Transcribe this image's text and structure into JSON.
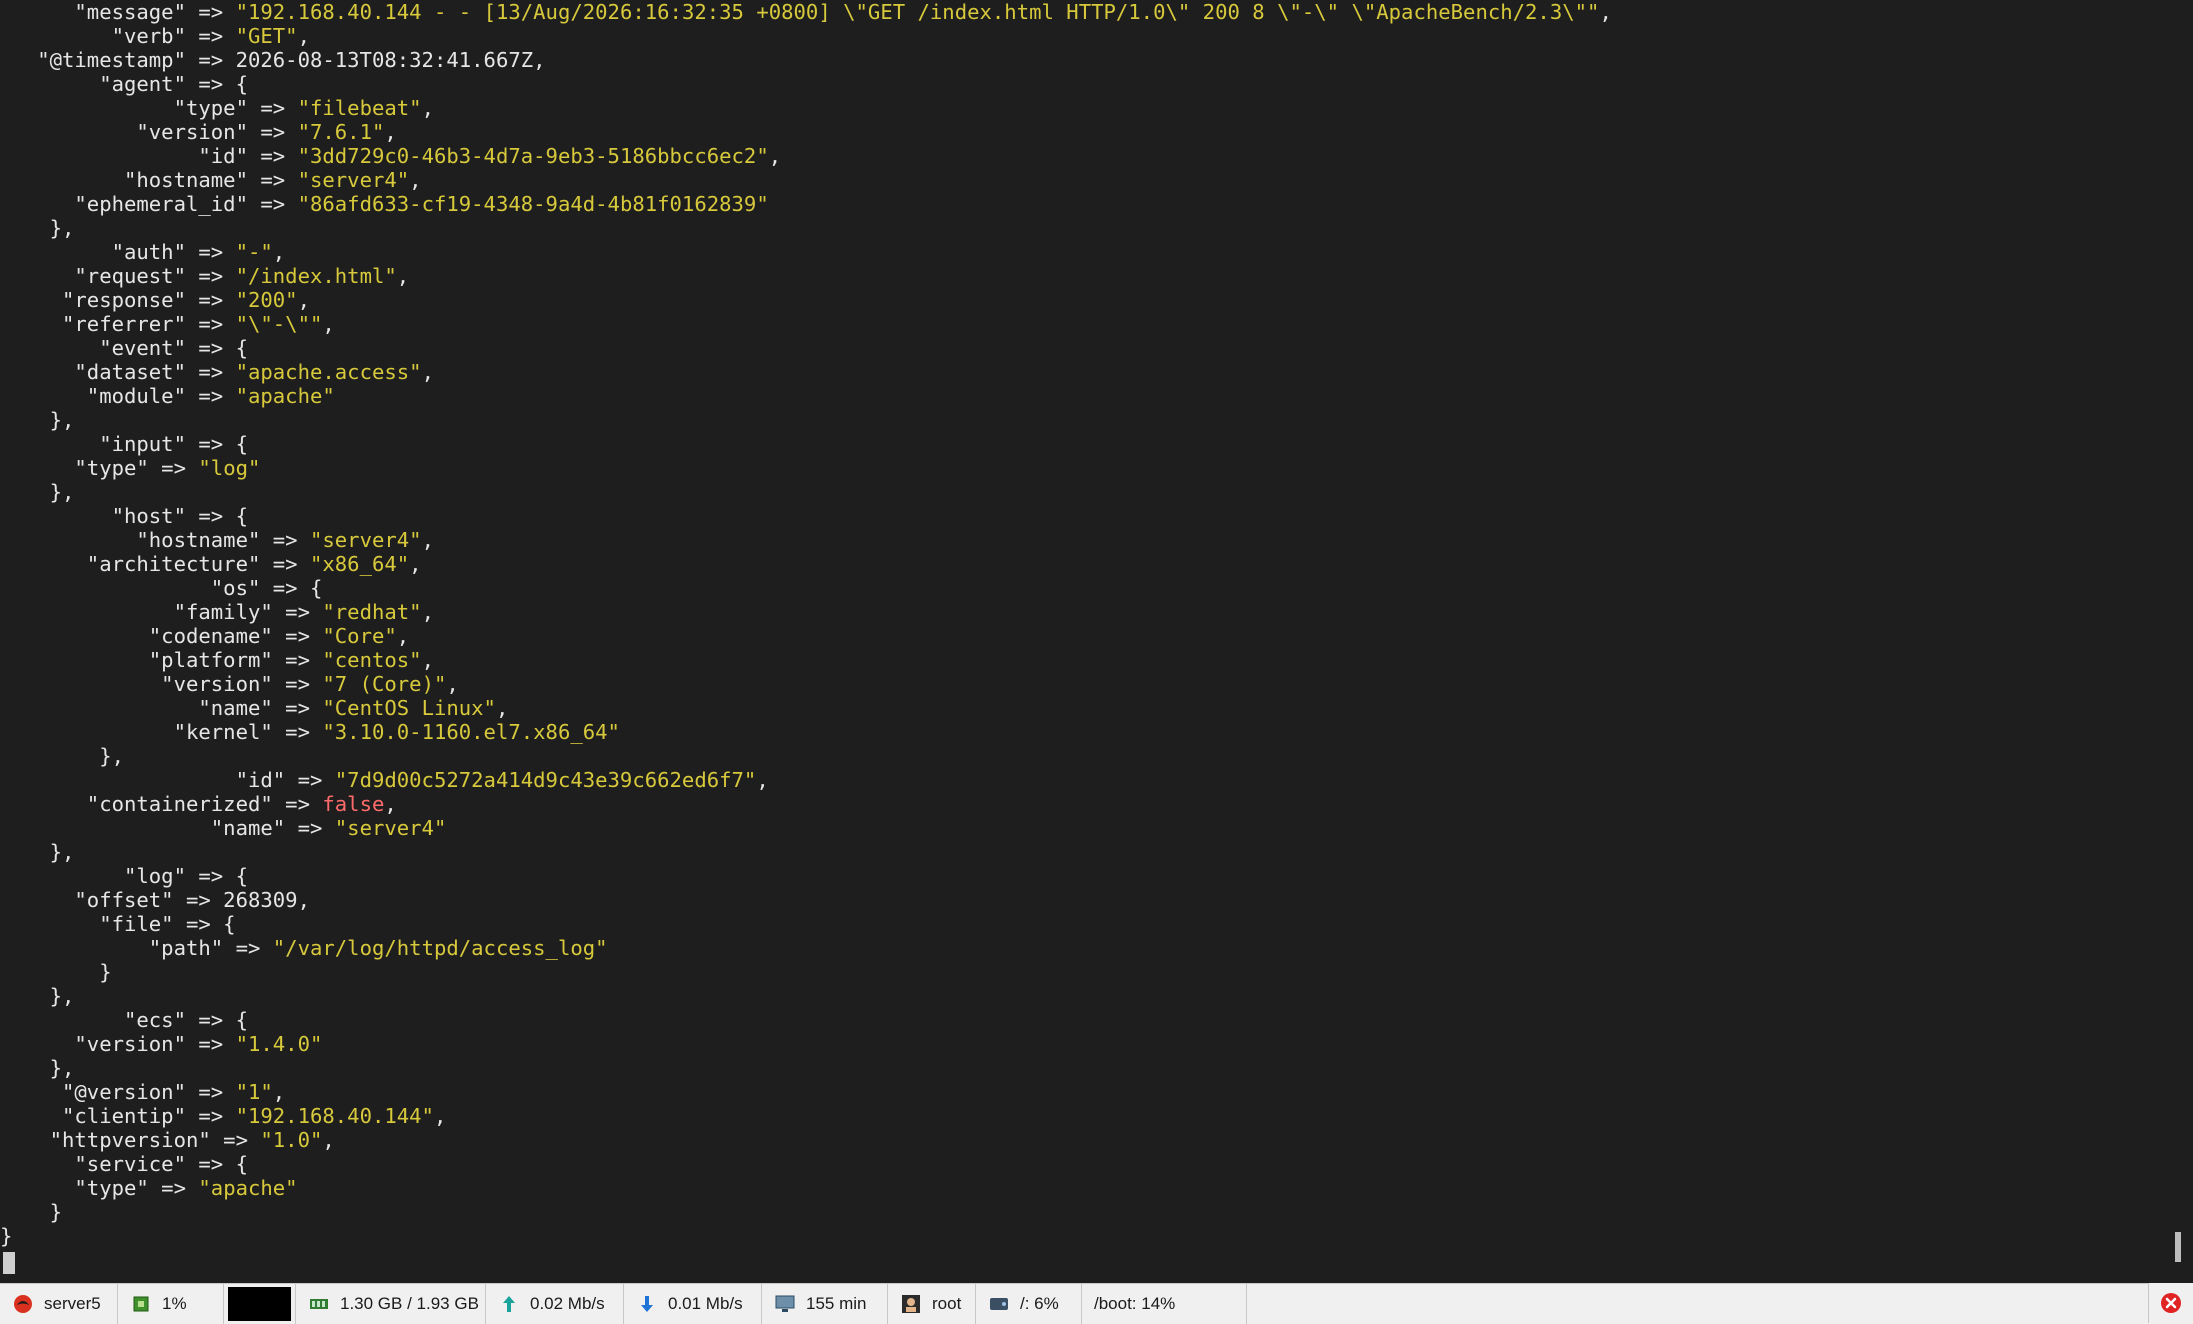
{
  "terminal": {
    "lines": [
      [
        {
          "t": "k",
          "v": "      \"message\""
        },
        {
          "t": "k",
          "v": " => "
        },
        {
          "t": "s",
          "v": "\"192.168.40.144 - - [13/Aug/2026:16:32:35 +0800] \\\"GET /index.html HTTP/1.0\\\" 200 8 \\\"-\\\" \\\"ApacheBench/2.3\\\"\""
        },
        {
          "t": "k",
          "v": ","
        }
      ],
      [
        {
          "t": "k",
          "v": "         \"verb\" => "
        },
        {
          "t": "s",
          "v": "\"GET\""
        },
        {
          "t": "k",
          "v": ","
        }
      ],
      [
        {
          "t": "k",
          "v": "   \"@timestamp\" => 2026-08-13T08:32:41.667Z,"
        }
      ],
      [
        {
          "t": "k",
          "v": "        \"agent\" => {"
        }
      ],
      [
        {
          "t": "k",
          "v": "              \"type\" => "
        },
        {
          "t": "s",
          "v": "\"filebeat\""
        },
        {
          "t": "k",
          "v": ","
        }
      ],
      [
        {
          "t": "k",
          "v": "           \"version\" => "
        },
        {
          "t": "s",
          "v": "\"7.6.1\""
        },
        {
          "t": "k",
          "v": ","
        }
      ],
      [
        {
          "t": "k",
          "v": "                \"id\" => "
        },
        {
          "t": "s",
          "v": "\"3dd729c0-46b3-4d7a-9eb3-5186bbcc6ec2\""
        },
        {
          "t": "k",
          "v": ","
        }
      ],
      [
        {
          "t": "k",
          "v": "          \"hostname\" => "
        },
        {
          "t": "s",
          "v": "\"server4\""
        },
        {
          "t": "k",
          "v": ","
        }
      ],
      [
        {
          "t": "k",
          "v": "      \"ephemeral_id\" => "
        },
        {
          "t": "s",
          "v": "\"86afd633-cf19-4348-9a4d-4b81f0162839\""
        }
      ],
      [
        {
          "t": "k",
          "v": "    },"
        }
      ],
      [
        {
          "t": "k",
          "v": "         \"auth\" => "
        },
        {
          "t": "s",
          "v": "\"-\""
        },
        {
          "t": "k",
          "v": ","
        }
      ],
      [
        {
          "t": "k",
          "v": "      \"request\" => "
        },
        {
          "t": "s",
          "v": "\"/index.html\""
        },
        {
          "t": "k",
          "v": ","
        }
      ],
      [
        {
          "t": "k",
          "v": "     \"response\" => "
        },
        {
          "t": "s",
          "v": "\"200\""
        },
        {
          "t": "k",
          "v": ","
        }
      ],
      [
        {
          "t": "k",
          "v": "     \"referrer\" => "
        },
        {
          "t": "s",
          "v": "\"\\\"-\\\"\""
        },
        {
          "t": "k",
          "v": ","
        }
      ],
      [
        {
          "t": "k",
          "v": "        \"event\" => {"
        }
      ],
      [
        {
          "t": "k",
          "v": "      \"dataset\" => "
        },
        {
          "t": "s",
          "v": "\"apache.access\""
        },
        {
          "t": "k",
          "v": ","
        }
      ],
      [
        {
          "t": "k",
          "v": "       \"module\" => "
        },
        {
          "t": "s",
          "v": "\"apache\""
        }
      ],
      [
        {
          "t": "k",
          "v": "    },"
        }
      ],
      [
        {
          "t": "k",
          "v": "        \"input\" => {"
        }
      ],
      [
        {
          "t": "k",
          "v": "      \"type\" => "
        },
        {
          "t": "s",
          "v": "\"log\""
        }
      ],
      [
        {
          "t": "k",
          "v": "    },"
        }
      ],
      [
        {
          "t": "k",
          "v": "         \"host\" => {"
        }
      ],
      [
        {
          "t": "k",
          "v": "           \"hostname\" => "
        },
        {
          "t": "s",
          "v": "\"server4\""
        },
        {
          "t": "k",
          "v": ","
        }
      ],
      [
        {
          "t": "k",
          "v": "       \"architecture\" => "
        },
        {
          "t": "s",
          "v": "\"x86_64\""
        },
        {
          "t": "k",
          "v": ","
        }
      ],
      [
        {
          "t": "k",
          "v": "                 \"os\" => {"
        }
      ],
      [
        {
          "t": "k",
          "v": "              \"family\" => "
        },
        {
          "t": "s",
          "v": "\"redhat\""
        },
        {
          "t": "k",
          "v": ","
        }
      ],
      [
        {
          "t": "k",
          "v": "            \"codename\" => "
        },
        {
          "t": "s",
          "v": "\"Core\""
        },
        {
          "t": "k",
          "v": ","
        }
      ],
      [
        {
          "t": "k",
          "v": "            \"platform\" => "
        },
        {
          "t": "s",
          "v": "\"centos\""
        },
        {
          "t": "k",
          "v": ","
        }
      ],
      [
        {
          "t": "k",
          "v": "             \"version\" => "
        },
        {
          "t": "s",
          "v": "\"7 (Core)\""
        },
        {
          "t": "k",
          "v": ","
        }
      ],
      [
        {
          "t": "k",
          "v": "                \"name\" => "
        },
        {
          "t": "s",
          "v": "\"CentOS Linux\""
        },
        {
          "t": "k",
          "v": ","
        }
      ],
      [
        {
          "t": "k",
          "v": "              \"kernel\" => "
        },
        {
          "t": "s",
          "v": "\"3.10.0-1160.el7.x86_64\""
        }
      ],
      [
        {
          "t": "k",
          "v": "        },"
        }
      ],
      [
        {
          "t": "k",
          "v": "                   \"id\" => "
        },
        {
          "t": "s",
          "v": "\"7d9d00c5272a414d9c43e39c662ed6f7\""
        },
        {
          "t": "k",
          "v": ","
        }
      ],
      [
        {
          "t": "k",
          "v": "       \"containerized\" => "
        },
        {
          "t": "b",
          "v": "false"
        },
        {
          "t": "k",
          "v": ","
        }
      ],
      [
        {
          "t": "k",
          "v": "                 \"name\" => "
        },
        {
          "t": "s",
          "v": "\"server4\""
        }
      ],
      [
        {
          "t": "k",
          "v": "    },"
        }
      ],
      [
        {
          "t": "k",
          "v": "          \"log\" => {"
        }
      ],
      [
        {
          "t": "k",
          "v": "      \"offset\" => 268309,"
        }
      ],
      [
        {
          "t": "k",
          "v": "        \"file\" => {"
        }
      ],
      [
        {
          "t": "k",
          "v": "            \"path\" => "
        },
        {
          "t": "s",
          "v": "\"/var/log/httpd/access_log\""
        }
      ],
      [
        {
          "t": "k",
          "v": "        }"
        }
      ],
      [
        {
          "t": "k",
          "v": "    },"
        }
      ],
      [
        {
          "t": "k",
          "v": "          \"ecs\" => {"
        }
      ],
      [
        {
          "t": "k",
          "v": "      \"version\" => "
        },
        {
          "t": "s",
          "v": "\"1.4.0\""
        }
      ],
      [
        {
          "t": "k",
          "v": "    },"
        }
      ],
      [
        {
          "t": "k",
          "v": "     \"@version\" => "
        },
        {
          "t": "s",
          "v": "\"1\""
        },
        {
          "t": "k",
          "v": ","
        }
      ],
      [
        {
          "t": "k",
          "v": "     \"clientip\" => "
        },
        {
          "t": "s",
          "v": "\"192.168.40.144\""
        },
        {
          "t": "k",
          "v": ","
        }
      ],
      [
        {
          "t": "k",
          "v": "    \"httpversion\" => "
        },
        {
          "t": "s",
          "v": "\"1.0\""
        },
        {
          "t": "k",
          "v": ","
        }
      ],
      [
        {
          "t": "k",
          "v": "      \"service\" => {"
        }
      ],
      [
        {
          "t": "k",
          "v": "      \"type\" => "
        },
        {
          "t": "s",
          "v": "\"apache\""
        }
      ],
      [
        {
          "t": "k",
          "v": "    }"
        }
      ],
      [
        {
          "t": "k",
          "v": "}"
        }
      ]
    ]
  },
  "colors": {
    "background": "#1e1e1e",
    "key": "#e6e6e6",
    "string": "#d7c93b",
    "boolean": "#ff6b6b"
  },
  "statusbar": {
    "session_name": "server5",
    "cpu": "1%",
    "memory": "1.30 GB / 1.93 GB",
    "upload": "0.02 Mb/s",
    "download": "0.01 Mb/s",
    "uptime": "155 min",
    "user": "root",
    "disk_root": "/: 6%",
    "disk_boot": "/boot: 14%",
    "icons": [
      "server-icon",
      "cpu-icon",
      "memory-icon",
      "upload-icon",
      "download-icon",
      "monitor-icon",
      "user-icon",
      "disk-icon",
      "close-icon"
    ]
  }
}
